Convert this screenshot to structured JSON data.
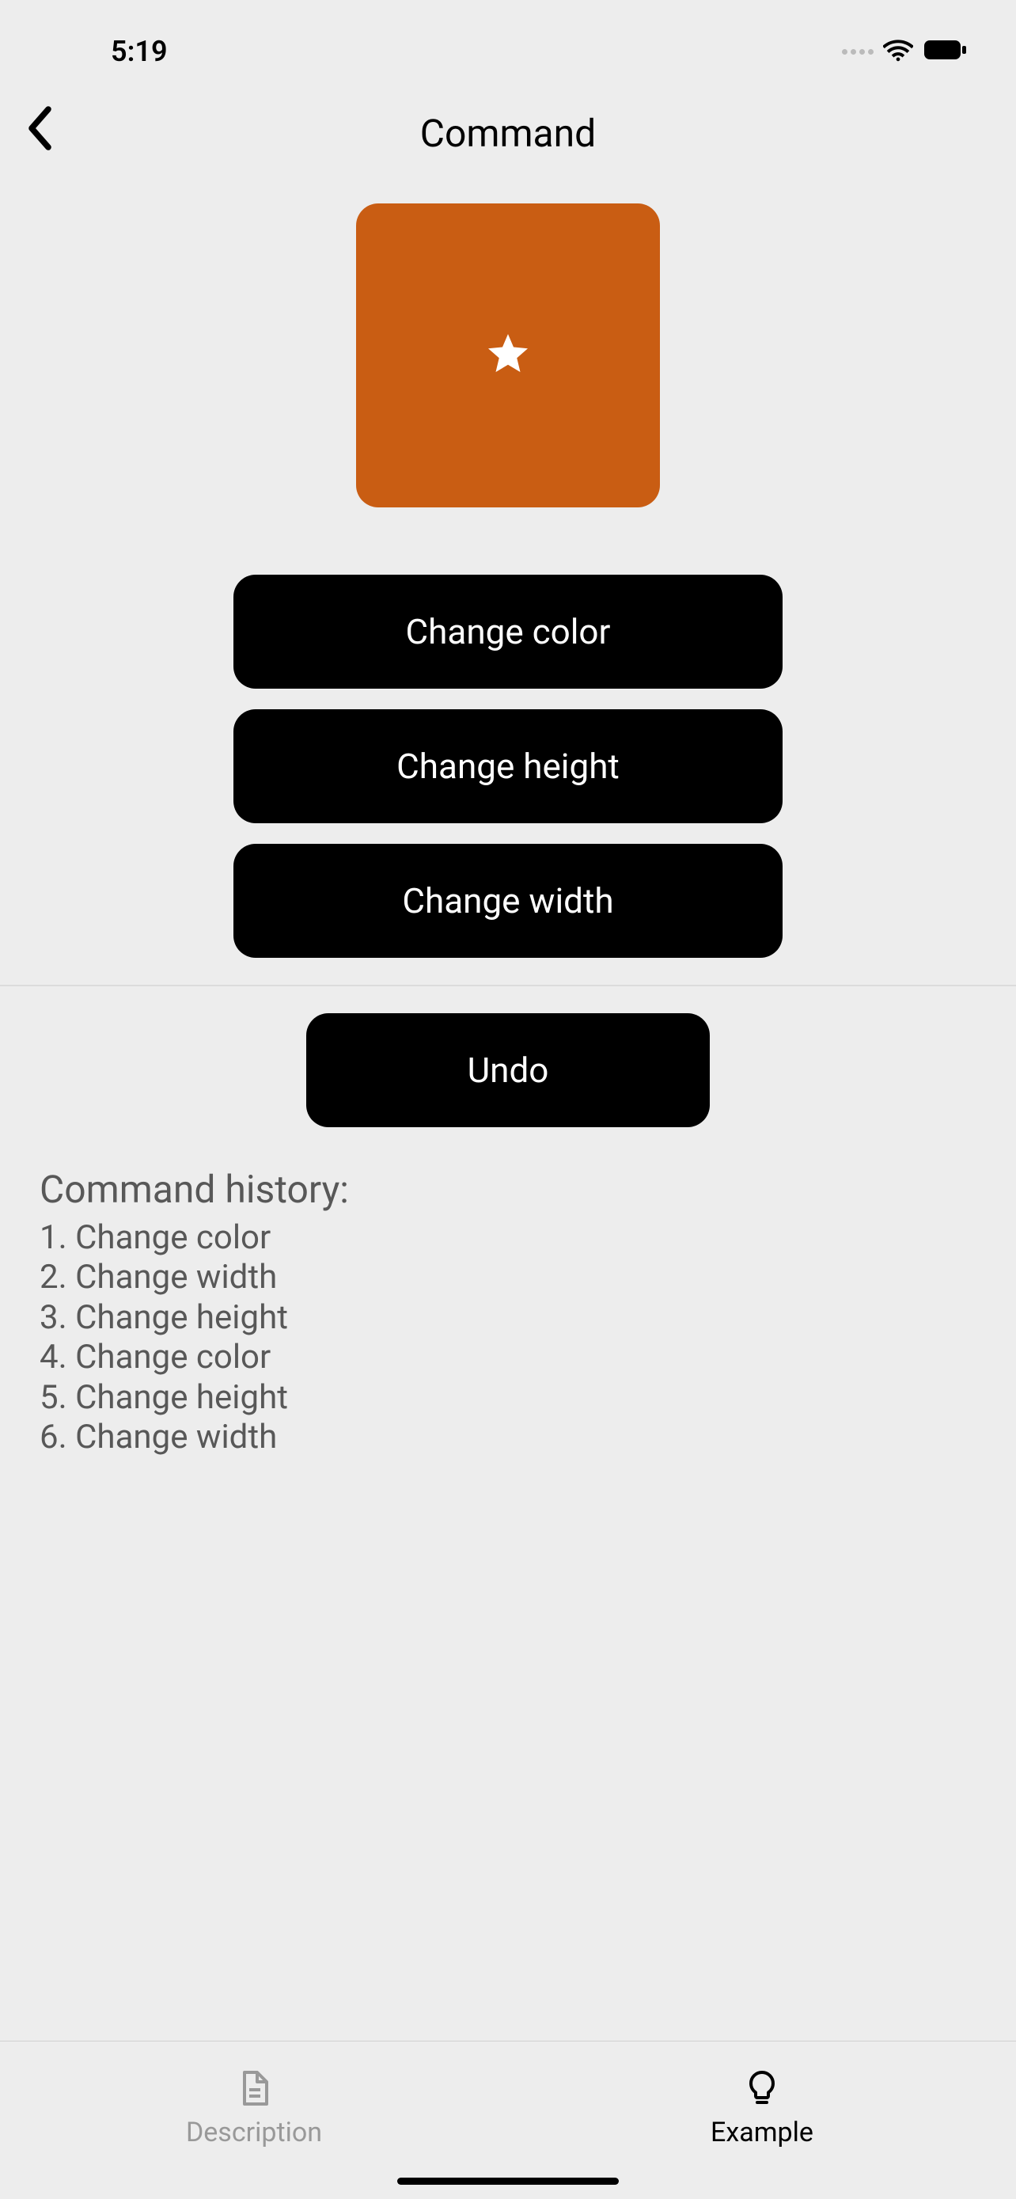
{
  "statusBar": {
    "time": "5:19"
  },
  "header": {
    "title": "Command"
  },
  "shape": {
    "color": "#c95d13"
  },
  "buttons": {
    "changeColor": "Change color",
    "changeHeight": "Change height",
    "changeWidth": "Change width",
    "undo": "Undo"
  },
  "history": {
    "title": "Command history:",
    "items": [
      "1. Change color",
      "2. Change width",
      "3. Change height",
      "4. Change color",
      "5. Change height",
      "6. Change width"
    ]
  },
  "tabs": {
    "description": "Description",
    "example": "Example"
  }
}
